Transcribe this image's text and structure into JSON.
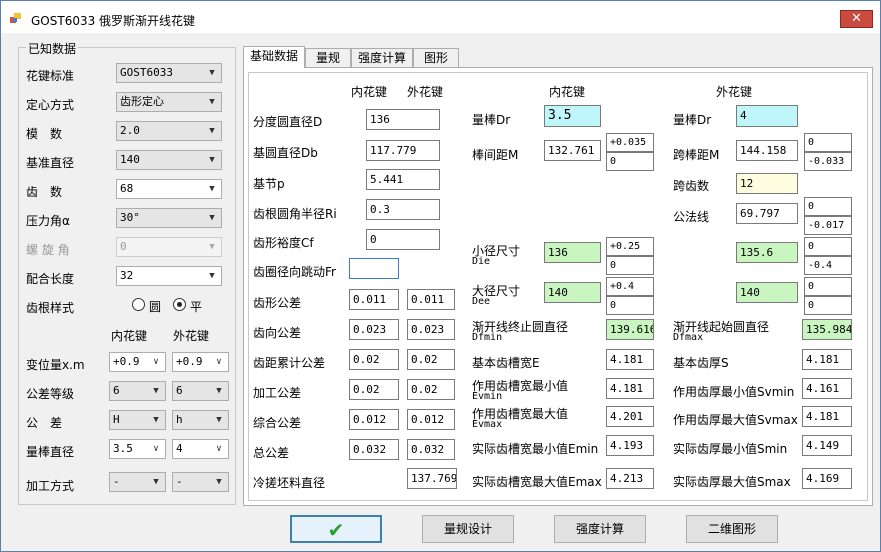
{
  "window": {
    "title": "GOST6033 俄罗斯渐开线花键",
    "close": "✕"
  },
  "known": {
    "title": "已知数据",
    "rows": [
      {
        "label": "花键标准",
        "value": "GOST6033"
      },
      {
        "label": "定心方式",
        "value": "齿形定心"
      },
      {
        "label": "模　数",
        "value": "2.0"
      },
      {
        "label": "基准直径",
        "value": "140"
      },
      {
        "label": "齿　数",
        "value": "68"
      },
      {
        "label": "压力角α",
        "value": "30°"
      },
      {
        "label": "螺 旋 角",
        "value": "0"
      },
      {
        "label": "配合长度",
        "value": "32"
      }
    ],
    "root_label": "齿根样式",
    "root_opt1": "圆",
    "root_opt2": "平",
    "col_inner": "内花键",
    "col_outer": "外花键",
    "pairs": [
      {
        "label": "变位量x.m",
        "inner": "+0.9",
        "outer": "+0.9"
      },
      {
        "label": "公差等级",
        "inner": "6",
        "outer": "6"
      },
      {
        "label": "公　差",
        "inner": "H",
        "outer": "h"
      },
      {
        "label": "量棒直径",
        "inner": "3.5",
        "outer": "4"
      },
      {
        "label": "加工方式",
        "inner": "-",
        "outer": "-"
      }
    ]
  },
  "tabs": [
    "基础数据",
    "量规",
    "强度计算",
    "图形"
  ],
  "basic": {
    "h_inner": "内花键",
    "h_outer": "外花键",
    "pitch_d": {
      "label": "分度圆直径D",
      "value": "136"
    },
    "base_d": {
      "label": "基圆直径Db",
      "value": "117.779"
    },
    "base_pitch": {
      "label": "基节p",
      "value": "5.441"
    },
    "root_r": {
      "label": "齿根圆角半径Ri",
      "value": "0.3"
    },
    "form_clear": {
      "label": "齿形裕度Cf",
      "value": "0"
    },
    "runout": {
      "label": "齿圈径向跳动Fr",
      "value": ""
    },
    "tol": [
      {
        "label": "齿形公差",
        "inner": "0.011",
        "outer": "0.011"
      },
      {
        "label": "齿向公差",
        "inner": "0.023",
        "outer": "0.023"
      },
      {
        "label": "齿距累计公差",
        "inner": "0.02",
        "outer": "0.02"
      },
      {
        "label": "加工公差",
        "inner": "0.02",
        "outer": "0.02"
      },
      {
        "label": "综合公差",
        "inner": "0.012",
        "outer": "0.012"
      },
      {
        "label": "总公差",
        "inner": "0.032",
        "outer": "0.032"
      }
    ],
    "blank": {
      "label": "冷搓坯料直径",
      "value": "137.769"
    }
  },
  "inner": {
    "head": "内花键",
    "pin_label": "量棒Dr",
    "pin": "3.5",
    "bp_label": "棒间距M",
    "bp": "132.761",
    "bp_up": "+0.035",
    "bp_lo": "0",
    "minor_label": "小径尺寸",
    "minor_sub": "Die",
    "minor": "136",
    "minor_up": "+0.25",
    "minor_lo": "0",
    "major_label": "大径尺寸",
    "major_sub": "Dee",
    "major": "140",
    "major_up": "+0.4",
    "major_lo": "0",
    "invend_label": "渐开线终止圆直径",
    "invend_sub": "Dfmin",
    "invend": "139.616",
    "E_label": "基本齿槽宽E",
    "E": "4.181",
    "Evmin_label": "作用齿槽宽最小值",
    "Evmin_sub": "Evmin",
    "Evmin": "4.181",
    "Evmax_label": "作用齿槽宽最大值",
    "Evmax_sub": "Evmax",
    "Evmax": "4.201",
    "Emin_label": "实际齿槽宽最小值Emin",
    "Emin": "4.193",
    "Emax_label": "实际齿槽宽最大值Emax",
    "Emax": "4.213"
  },
  "outer": {
    "head": "外花键",
    "pin_label": "量棒Dr",
    "pin": "4",
    "span_label": "跨棒距M",
    "span": "144.158",
    "span_up": "0",
    "span_lo": "-0.033",
    "k_label": "跨齿数",
    "k": "12",
    "wn_label": "公法线",
    "wn": "69.797",
    "wn_up": "0",
    "wn_lo": "-0.017",
    "minor": "135.6",
    "minor_up": "0",
    "minor_lo": "-0.4",
    "major": "140",
    "major_up": "0",
    "major_lo": "0",
    "invstart_label": "渐开线起始圆直径",
    "invstart_sub": "Dfmax",
    "invstart": "135.984",
    "S_label": "基本齿厚S",
    "S": "4.181",
    "Svmin_label": "作用齿厚最小值Svmin",
    "Svmin": "4.161",
    "Svmax_label": "作用齿厚最大值Svmax",
    "Svmax": "4.181",
    "Smin_label": "实际齿厚最小值Smin",
    "Smin": "4.149",
    "Smax_label": "实际齿厚最大值Smax",
    "Smax": "4.169"
  },
  "buttons": {
    "ok": "✔",
    "gauge": "量规设计",
    "strength": "强度计算",
    "graph": "二维图形"
  },
  "colors": {
    "ok_check": "#2e9e2e",
    "cyan": "#bff6fa",
    "green": "#c8f5c0",
    "yellow": "#fffde0"
  }
}
